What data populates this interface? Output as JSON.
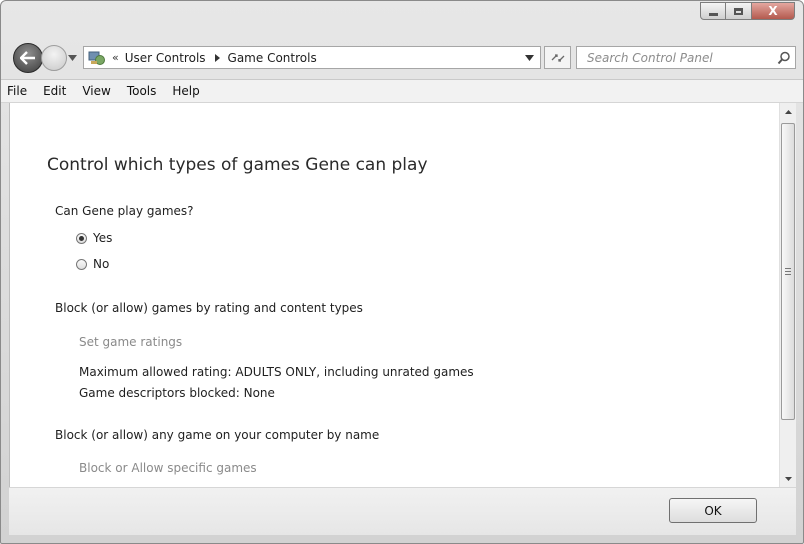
{
  "window": {
    "caption_buttons": {
      "minimize_icon": "minimize-icon",
      "maximize_icon": "maximize-icon",
      "close_icon": "close-icon",
      "close_glyph": "X"
    }
  },
  "navigation": {
    "breadcrumb": {
      "overflow": "«",
      "items": [
        "User Controls",
        "Game Controls"
      ]
    },
    "search": {
      "placeholder": "Search Control Panel"
    }
  },
  "menu": [
    "File",
    "Edit",
    "View",
    "Tools",
    "Help"
  ],
  "main": {
    "heading": "Control which types of games Gene can play",
    "play_question": "Can Gene play games?",
    "options": [
      {
        "label": "Yes",
        "checked": true
      },
      {
        "label": "No",
        "checked": false
      }
    ],
    "rating_section": {
      "title": "Block (or allow) games by rating and content types",
      "link": "Set game ratings",
      "max_rating_label": "Maximum allowed rating:",
      "max_rating_value": "ADULTS ONLY, including unrated games",
      "descriptors_label": "Game descriptors blocked:",
      "descriptors_value": "None"
    },
    "name_section": {
      "title": "Block (or allow) any game on your computer by name",
      "link": "Block or Allow specific games"
    }
  },
  "footer": {
    "ok_label": "OK"
  },
  "colors": {
    "link": "#8a8a8a",
    "heading": "#2a2a2a",
    "close_button": "#c0584b"
  }
}
